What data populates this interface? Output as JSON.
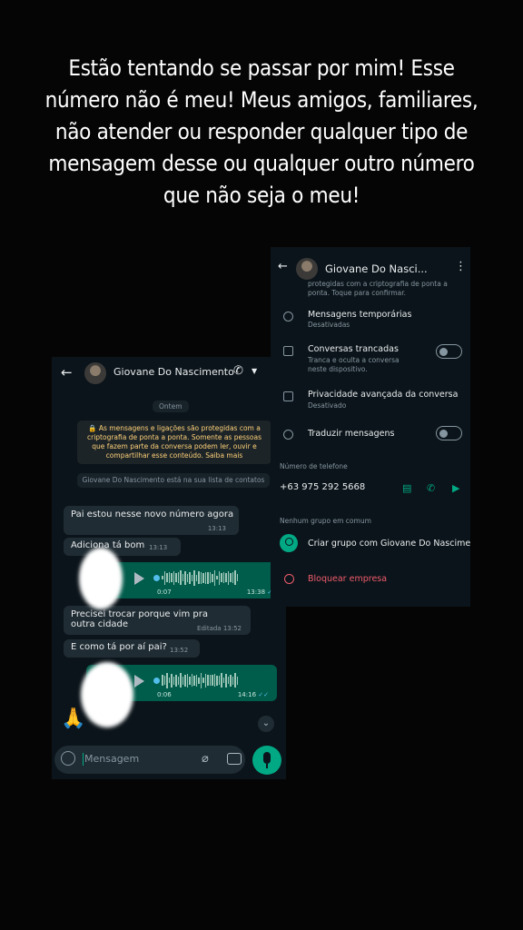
{
  "caption": [
    "Estão tentando se passar por mim! Esse",
    "número não é meu! Meus amigos, familiares,",
    "não atender ou responder qualquer tipo de",
    "mensagem desse ou qualquer outro número",
    "que não seja o meu!"
  ],
  "chat": {
    "contact_name": "Giovane Do Nascimento",
    "date_label": "Ontem",
    "encryption_notice": "🔒 As mensagens e ligações são protegidas com a criptografia de ponta a ponta. Somente as pessoas que fazem parte da conversa podem ler, ouvir e compartilhar esse conteúdo. Saiba mais",
    "contact_note": "Giovane Do Nascimento está na sua lista de contatos",
    "messages": [
      {
        "text": "Pai estou nesse novo número agora",
        "time": "13:13"
      },
      {
        "text": "Adiciona tá bom",
        "time": "13:13"
      },
      {
        "duration": "0:07",
        "time": "13:38"
      },
      {
        "text": "Precisei trocar porque vim pra outra cidade",
        "time": "Editada  13:52"
      },
      {
        "text": "E como tá por aí pai?",
        "time": "13:52"
      },
      {
        "duration": "0:06",
        "time": "14:16"
      }
    ],
    "emoji": "🙏",
    "composer_placeholder": "Mensagem"
  },
  "info": {
    "header_name": "Giovane Do Nasci...",
    "cut_text": [
      "protegidas com a criptografia de ponta a",
      "ponta. Toque para confirmar."
    ],
    "temp_title": "Mensagens temporárias",
    "temp_sub": "Desativadas",
    "locked_title": "Conversas trancadas",
    "locked_sub": [
      "Tranca e oculta a conversa",
      "neste dispositivo."
    ],
    "privacy_title": "Privacidade avançada da conversa",
    "privacy_sub": "Desativado",
    "translate_title": "Traduzir mensagens",
    "phone_section": "Número de telefone",
    "phone_number": "+63 975 292 5668",
    "groups_section": "Nenhum grupo em comum",
    "create_group": "Criar grupo com Giovane Do Nascimento",
    "block": "Bloquear empresa"
  },
  "colors": {
    "background": "#050505",
    "whatsapp_green": "#00a884",
    "outgoing_bubble": "#005c4b",
    "incoming_bubble": "#202c33",
    "danger": "#f15c6d"
  }
}
